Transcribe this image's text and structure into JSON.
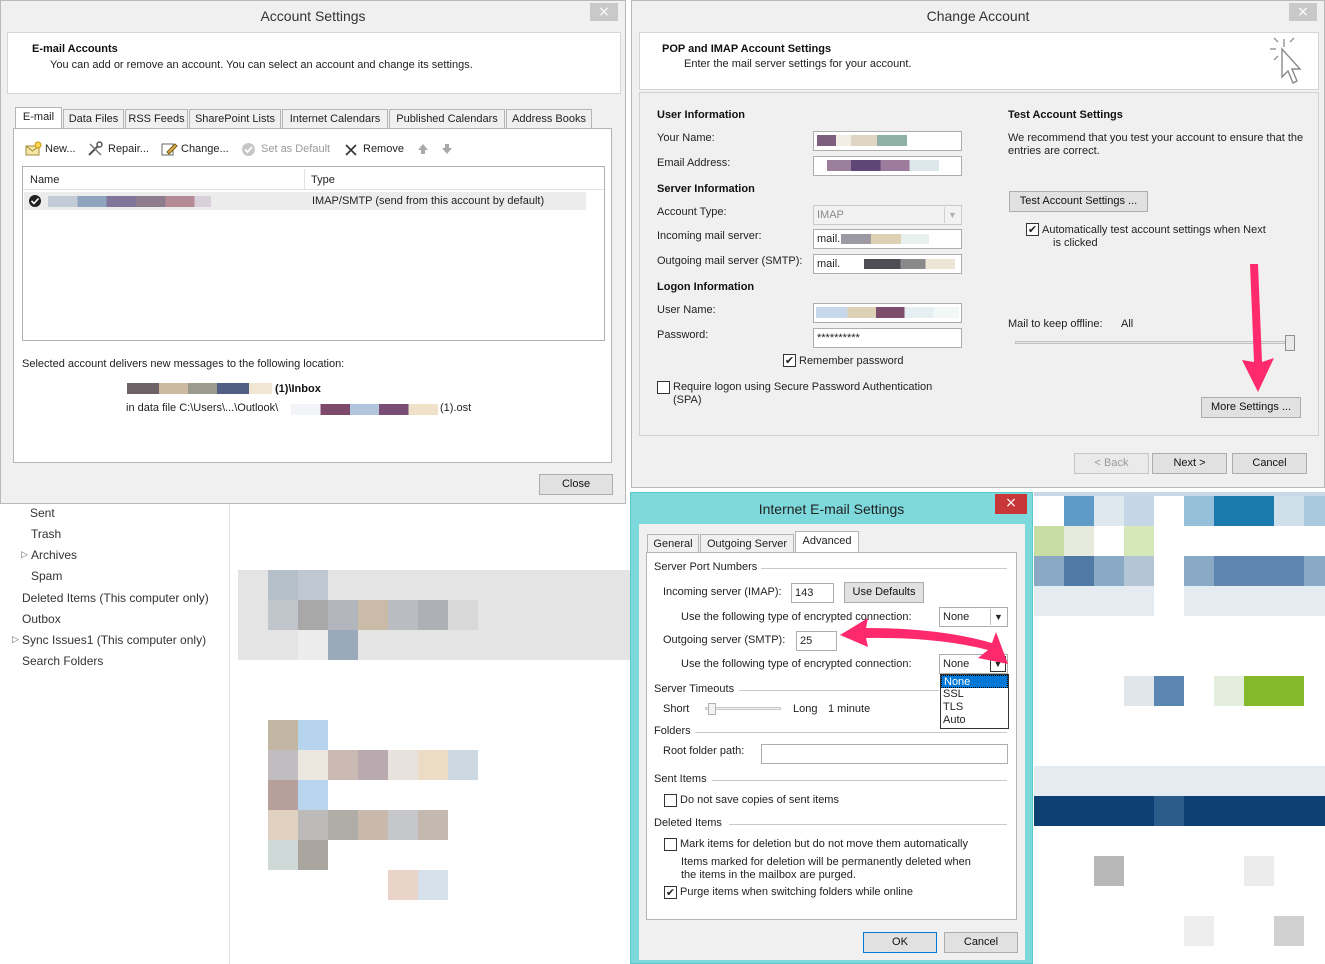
{
  "outlook_bg": {
    "folders": [
      "Sent",
      "Trash",
      "Archives",
      "Spam",
      "Deleted Items (This computer only)",
      "Outbox",
      "Sync Issues1 (This computer only)",
      "Search Folders"
    ]
  },
  "account_settings": {
    "title": "Account Settings",
    "close_icon": "×",
    "header_title": "E-mail Accounts",
    "header_desc": "You can add or remove an account. You can select an account and change its settings.",
    "tabs": [
      "E-mail",
      "Data Files",
      "RSS Feeds",
      "SharePoint Lists",
      "Internet Calendars",
      "Published Calendars",
      "Address Books"
    ],
    "toolbar": {
      "new": "New...",
      "repair": "Repair...",
      "change": "Change...",
      "set_default": "Set as Default",
      "remove": "Remove"
    },
    "columns": {
      "name": "Name",
      "type": "Type"
    },
    "account_row": {
      "type": "IMAP/SMTP (send from this account by default)"
    },
    "deliver_label": "Selected account delivers new messages to the following location:",
    "inbox_suffix": "(1)\\Inbox",
    "datafile_prefix": "in data file C:\\Users\\...\\Outlook\\",
    "datafile_suffix": "(1).ost",
    "close_button": "Close"
  },
  "change_account": {
    "title": "Change Account",
    "close_icon": "×",
    "header_title": "POP and IMAP Account Settings",
    "header_desc": "Enter the mail server settings for your account.",
    "user_info": "User Information",
    "your_name": "Your Name:",
    "email_address": "Email Address:",
    "server_info": "Server Information",
    "account_type": "Account Type:",
    "account_type_value": "IMAP",
    "incoming_server": "Incoming mail server:",
    "incoming_value": "mail.",
    "outgoing_server": "Outgoing mail server (SMTP):",
    "outgoing_value": "mail.",
    "logon_info": "Logon Information",
    "user_name": "User Name:",
    "password": "Password:",
    "password_value": "**********",
    "remember_password": "Remember password",
    "require_spa": "Require logon using Secure Password Authentication",
    "spa_suffix": "(SPA)",
    "test_title": "Test Account Settings",
    "test_desc": "We recommend that you test your account to ensure that the entries are correct.",
    "test_button": "Test Account Settings ...",
    "auto_test_1": "Automatically test account settings when Next",
    "auto_test_2": "is clicked",
    "offline_label": "Mail to keep offline:",
    "offline_value": "All",
    "offline_level": 1.0,
    "more_settings": "More Settings ...",
    "back": "< Back",
    "next": "Next >",
    "cancel": "Cancel"
  },
  "internet_email": {
    "title": "Internet E-mail Settings",
    "close_icon": "×",
    "tabs": [
      "General",
      "Outgoing Server",
      "Advanced"
    ],
    "server_ports": "Server Port Numbers",
    "incoming_label": "Incoming server (IMAP):",
    "incoming_port": "143",
    "use_defaults": "Use Defaults",
    "enc_label": "Use the following type of encrypted connection:",
    "enc_incoming": "None",
    "outgoing_label": "Outgoing server (SMTP):",
    "outgoing_port": "25",
    "enc_outgoing": "None",
    "enc_options": [
      "None",
      "SSL",
      "TLS",
      "Auto"
    ],
    "timeouts": "Server Timeouts",
    "short": "Short",
    "long": "Long",
    "timeout_value": "1 minute",
    "timeout_level": 0.05,
    "folders": "Folders",
    "root_folder": "Root folder path:",
    "sent_items": "Sent Items",
    "no_copies": "Do not save copies of sent items",
    "deleted_items": "Deleted Items",
    "mark_deletion": "Mark items for deletion but do not move them automatically",
    "mark_note_1": "Items marked for deletion will be permanently deleted when",
    "mark_note_2": "the items in the mailbox are purged.",
    "purge": "Purge items when switching folders while online",
    "ok": "OK",
    "cancel": "Cancel"
  },
  "colors": {
    "annotation_arrow": "#ff2a6d",
    "dialog_border": "#5fcfd4",
    "selection": "#0078d7"
  },
  "icons": {
    "new": "new-mail-icon",
    "repair": "repair-tools-icon",
    "change": "change-edit-icon",
    "set_default": "check-circle-icon",
    "remove": "x-icon",
    "up": "arrow-up-icon",
    "down": "arrow-down-icon",
    "wizard": "cursor-sparkle-icon"
  }
}
